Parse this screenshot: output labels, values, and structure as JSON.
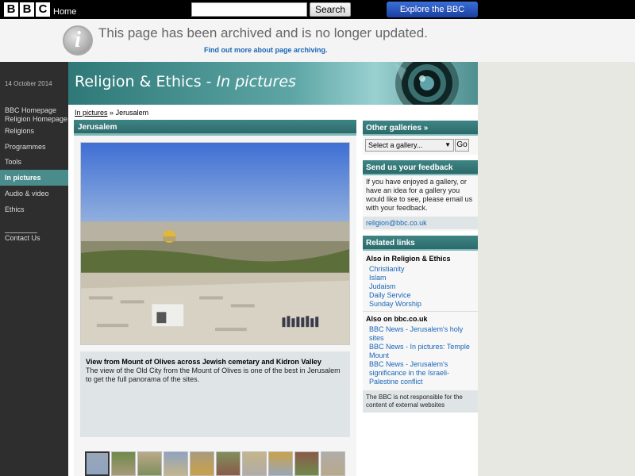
{
  "topbar": {
    "logo_letters": [
      "B",
      "B",
      "C"
    ],
    "home_label": "Home",
    "search_value": "",
    "search_button": "Search",
    "explore_label": "Explore the BBC"
  },
  "archive": {
    "icon": "info-icon",
    "message": "This page has been archived and is no longer updated.",
    "link": "Find out more about page archiving."
  },
  "sidebar": {
    "date": "14 October 2014",
    "links": [
      "BBC Homepage",
      "Religion Homepage",
      "Religions",
      "Programmes",
      "Tools",
      "In pictures",
      "Audio & video",
      "Ethics",
      "Contact Us"
    ],
    "active": "In pictures"
  },
  "header": {
    "title_plain": "Religion & Ethics - ",
    "title_italic": "In pictures",
    "image_icon": "camera-lens-icon"
  },
  "breadcrumb": {
    "parent": "In pictures",
    "separator": "»",
    "current": "Jerusalem"
  },
  "gallery": {
    "heading": "Jerusalem",
    "caption_title": "View from Mount of Olives across Jewish cemetary and Kidron Valley",
    "caption_text": "The view of the Old City from the Mount of Olives is one of the best in Jerusalem to get the full panorama of the sites.",
    "thumbnail_count": 10,
    "selected_thumbnail": 1
  },
  "right": {
    "other_galleries": {
      "heading": "Other galleries »",
      "select_value": "Select a gallery...",
      "go_label": "Go"
    },
    "feedback": {
      "heading": "Send us your feedback",
      "text": "If you have enjoyed a gallery, or have an idea for a gallery you would like to see, please email us with your feedback.",
      "email": "religion@bbc.co.uk"
    },
    "related": {
      "heading": "Related links",
      "group1_title": "Also in Religion & Ethics",
      "group1_links": [
        "Christianity",
        "Islam",
        "Judaism",
        "Daily Service",
        "Sunday Worship"
      ],
      "group2_title": "Also on bbc.co.uk",
      "group2_links": [
        "BBC News - Jerusalem's holy sites",
        "BBC News - In pictures: Temple Mount",
        "BBC News - Jerusalem's significance in the Israeli-Palestine conflict"
      ],
      "disclaimer": "The BBC is not responsible for the content of external websites"
    }
  },
  "colors": {
    "teal": "#3f8585",
    "link": "#1a66b8",
    "sidebar_bg": "#2e2e2e"
  }
}
